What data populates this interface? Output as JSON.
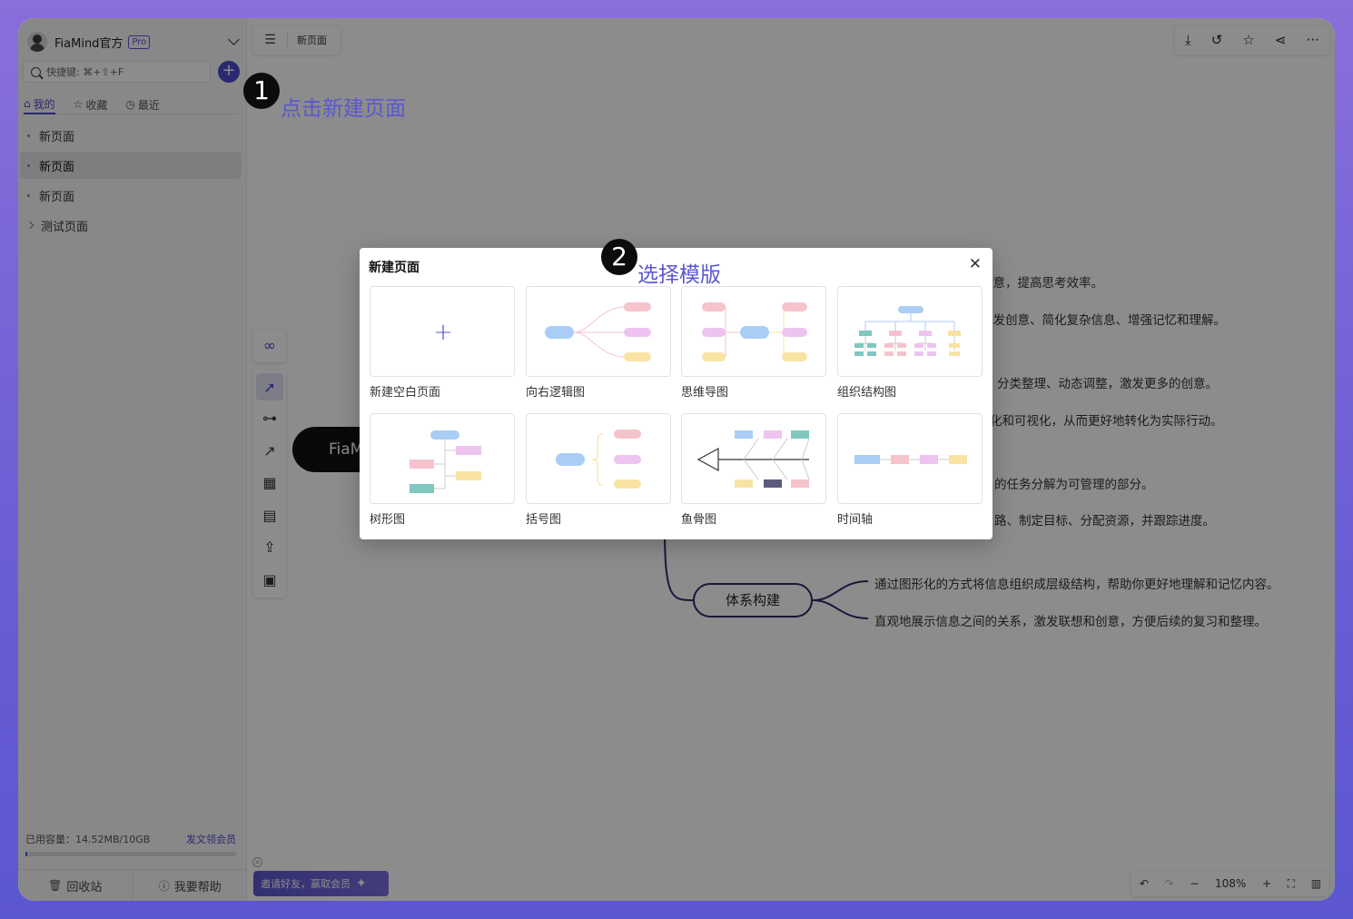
{
  "user": {
    "name": "FiaMind官方",
    "badge": "Pro"
  },
  "sidebar": {
    "search_placeholder": "快捷键: ⌘+⇧+F",
    "tabs": [
      {
        "label": "我的",
        "icon": "home-icon"
      },
      {
        "label": "收藏",
        "icon": "star-icon"
      },
      {
        "label": "最近",
        "icon": "clock-icon"
      }
    ],
    "pages": [
      {
        "label": "新页面"
      },
      {
        "label": "新页面"
      },
      {
        "label": "新页面"
      },
      {
        "label": "测试页面"
      }
    ],
    "storage_text": "已用容量：14.52MB/10GB",
    "upgrade_link": "发文领会员",
    "storage_used_fraction": 0.0014,
    "recycle_label": "回收站",
    "help_label": "我要帮助"
  },
  "topbar": {
    "page_title": "新页面"
  },
  "canvas": {
    "root_node_text": "FiaMind",
    "node_text": "体系构建",
    "branch_texts": [
      "创意，提高思考效率。",
      "激发创意、简化复杂信息、增强记忆和理解。",
      "分类整理、动态调整，激发更多的创意。",
      "化和可视化，从而更好地转化为实际行动。",
      "的任务分解为可管理的部分。",
      "路、制定目标、分配资源，并跟踪进度。",
      "通过图形化的方式将信息组织成层级结构，帮助你更好地理解和记忆内容。",
      "直观地展示信息之间的关系，激发联想和创意，方便后续的复习和整理。"
    ]
  },
  "invite": {
    "label": "邀请好友，赢取会员"
  },
  "zoom": {
    "level": "108%"
  },
  "annotations": [
    {
      "number": "1",
      "text": "点击新建页面"
    },
    {
      "number": "2",
      "text": "选择模版"
    }
  ],
  "dialog": {
    "title": "新建页面",
    "templates": [
      {
        "label": "新建空白页面"
      },
      {
        "label": "向右逻辑图"
      },
      {
        "label": "思维导图"
      },
      {
        "label": "组织结构图"
      },
      {
        "label": "树形图"
      },
      {
        "label": "括号图"
      },
      {
        "label": "鱼骨图"
      },
      {
        "label": "时间轴"
      }
    ]
  },
  "colors": {
    "accent": "#4d4ac9",
    "blue": "#a9cdf4",
    "pink": "#f5c3cc",
    "purple": "#eec3ef",
    "yellow": "#f9e3a3",
    "teal": "#7fc7bf"
  }
}
